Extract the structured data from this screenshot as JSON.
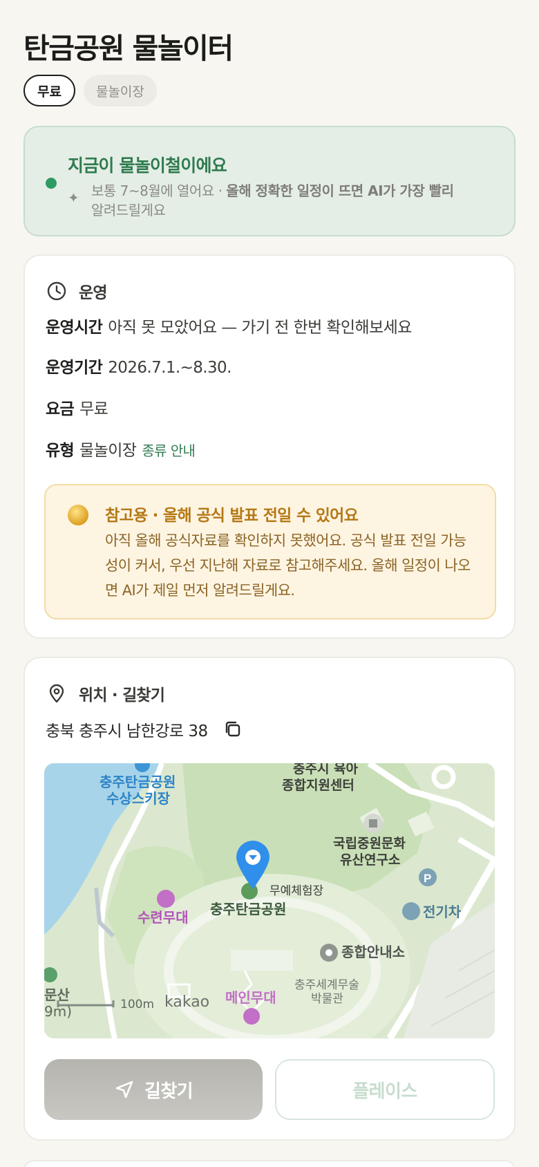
{
  "header": {
    "title": "탄금공원 물놀이터"
  },
  "chips": {
    "fee": "무료",
    "type": "물놀이장"
  },
  "season_banner": {
    "headline": "지금이 물놀이철이에요",
    "desc_plain": "보통 7~8월에 열어요 · ",
    "desc_bold": "올해 정확한 일정이 뜨면 AI가 가장 빨리",
    "desc_tail": "알려드릴게요",
    "icons": {
      "status": "green-dot",
      "sparkle": "sparkle-icon"
    }
  },
  "operation": {
    "section_title": "운영",
    "hours_label": "운영시간",
    "hours_value": "아직 못 모았어요 — 가기 전 한번 확인해보세요",
    "period_label": "운영기간",
    "period_value": "2026.7.1.~8.30.",
    "fee_label": "요금",
    "fee_value": "무료",
    "type_label": "유형",
    "type_value": "물놀이장",
    "type_link": "종류 안내",
    "notice": {
      "title": "참고용 · 올해 공식 발표 전일 수 있어요",
      "body": "아직 올해 공식자료를 확인하지 못했어요. 공식 발표 전일 가능성이 커서, 우선 지난해 자료로 참고해주세요. 올해 일정이 나오면 AI가 제일 먼저 알려드릴게요."
    }
  },
  "location": {
    "section_title": "위치 · 길찾기",
    "address": "충북 충주시 남한강로 38",
    "map": {
      "labels": {
        "water_ski": "충주탄금공원\n수상스키장",
        "childcare": "충주시 육아\n종합지원센터",
        "heritage": "국립중원문화\n유산연구소",
        "dance": "무예체험장",
        "park": "충주탄금공원",
        "suryeon": "수련무대",
        "ev": "전기차",
        "info": "종합안내소",
        "museum": "충주세계무술\n박물관",
        "main_stage": "메인무대",
        "mountain": "문산",
        "elevation": "9m)",
        "scale": "100m",
        "brand": "kakao"
      }
    },
    "route_button": "길찾기",
    "place_button": "플레이스"
  },
  "colors": {
    "brand_green": "#2f7b4f",
    "notice_gold": "#b47814",
    "pin_blue": "#2f8fea"
  }
}
